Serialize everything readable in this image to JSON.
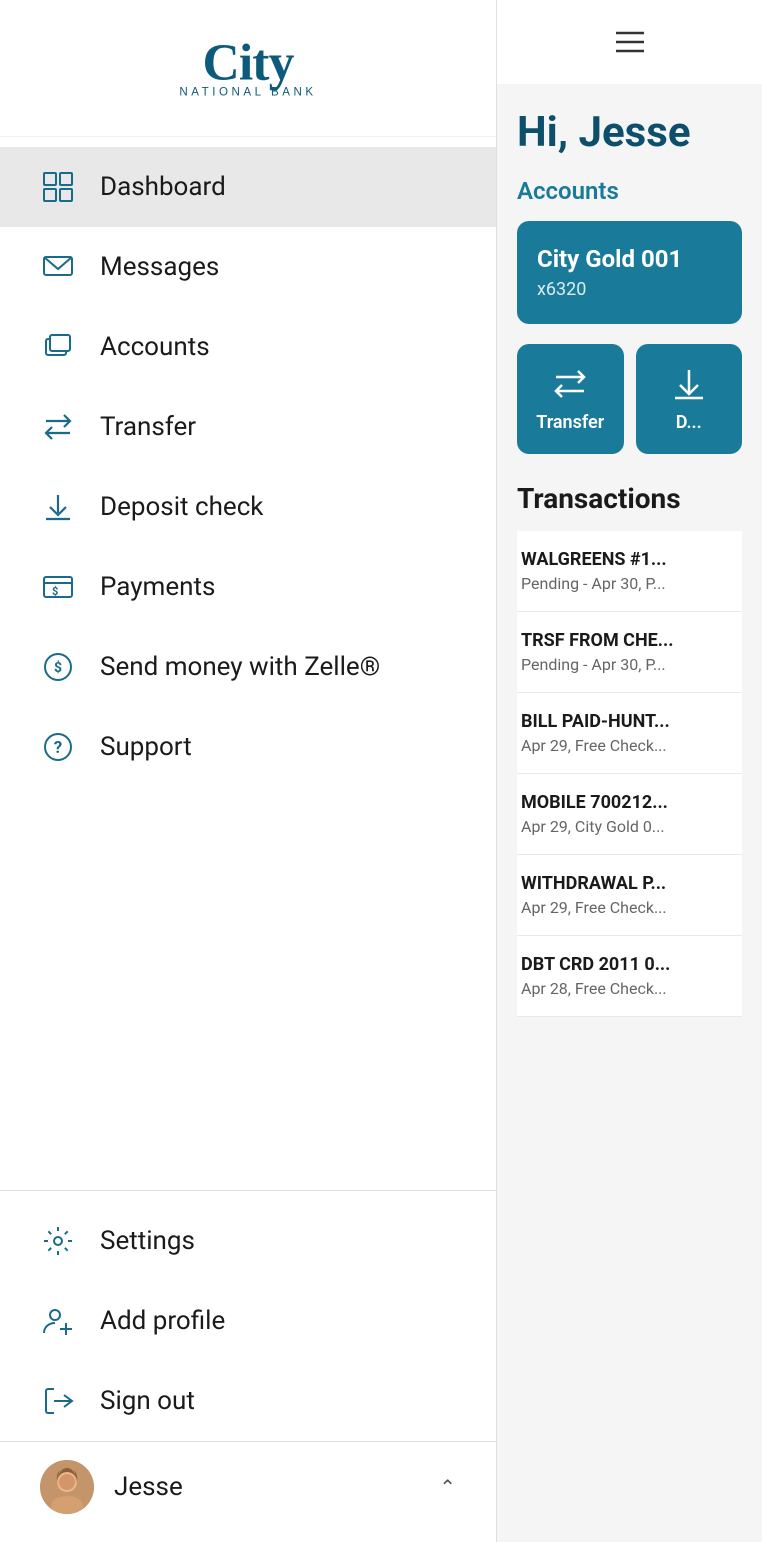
{
  "sidebar": {
    "logo_text": "City National Bank",
    "nav_items": [
      {
        "id": "dashboard",
        "label": "Dashboard",
        "icon": "dashboard-icon",
        "active": true
      },
      {
        "id": "messages",
        "label": "Messages",
        "icon": "messages-icon",
        "active": false
      },
      {
        "id": "accounts",
        "label": "Accounts",
        "icon": "accounts-icon",
        "active": false
      },
      {
        "id": "transfer",
        "label": "Transfer",
        "icon": "transfer-icon",
        "active": false
      },
      {
        "id": "deposit-check",
        "label": "Deposit check",
        "icon": "deposit-icon",
        "active": false
      },
      {
        "id": "payments",
        "label": "Payments",
        "icon": "payments-icon",
        "active": false
      },
      {
        "id": "zelle",
        "label": "Send money with Zelle®",
        "icon": "zelle-icon",
        "active": false
      },
      {
        "id": "support",
        "label": "Support",
        "icon": "support-icon",
        "active": false
      }
    ],
    "bottom_items": [
      {
        "id": "settings",
        "label": "Settings",
        "icon": "settings-icon"
      },
      {
        "id": "add-profile",
        "label": "Add profile",
        "icon": "add-profile-icon"
      },
      {
        "id": "sign-out",
        "label": "Sign out",
        "icon": "sign-out-icon"
      }
    ],
    "user": {
      "name": "Jesse",
      "avatar_alt": "Jesse avatar"
    }
  },
  "main": {
    "hamburger_label": "☰",
    "greeting": "Hi, Jesse",
    "accounts_section_title": "Accounts",
    "account_card": {
      "name": "City Gold 001",
      "number": "x6320"
    },
    "action_buttons": [
      {
        "id": "transfer-btn",
        "label": "Transfer",
        "icon": "↻"
      },
      {
        "id": "deposit-btn",
        "label": "D",
        "icon": "↓"
      }
    ],
    "transactions_title": "Transactions",
    "transactions": [
      {
        "name": "WALGREENS #1...",
        "detail": "Pending - Apr 30, P..."
      },
      {
        "name": "TRSF FROM CHE...",
        "detail": "Pending - Apr 30, P..."
      },
      {
        "name": "BILL PAID-HUNT...",
        "detail": "Apr 29, Free Check..."
      },
      {
        "name": "MOBILE 700212...",
        "detail": "Apr 29, City Gold 0..."
      },
      {
        "name": "WITHDRAWAL P...",
        "detail": "Apr 29, Free Check..."
      },
      {
        "name": "DBT CRD 2011 0...",
        "detail": "Apr 28, Free Check..."
      }
    ]
  }
}
